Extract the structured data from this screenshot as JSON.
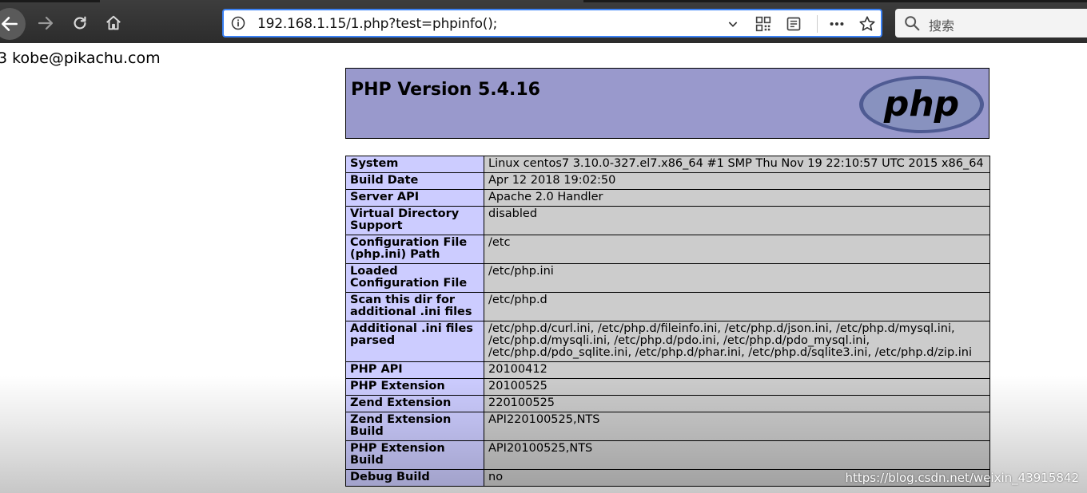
{
  "browser": {
    "url": "192.168.1.15/1.php?test=phpinfo();",
    "search_placeholder": "搜索",
    "icons": [
      "back-icon",
      "forward-icon",
      "reload-icon",
      "home-icon",
      "info-icon",
      "chevron-down-icon",
      "qr-code-icon",
      "reader-view-icon",
      "more-icon",
      "star-icon",
      "search-icon"
    ]
  },
  "page": {
    "email_text": "3 kobe@pikachu.com",
    "php_version": "PHP Version 5.4.16",
    "logo_text": "php",
    "rows": [
      {
        "key": "System",
        "value": "Linux centos7 3.10.0-327.el7.x86_64 #1 SMP Thu Nov 19 22:10:57 UTC 2015 x86_64"
      },
      {
        "key": "Build Date",
        "value": "Apr 12 2018 19:02:50"
      },
      {
        "key": "Server API",
        "value": "Apache 2.0 Handler"
      },
      {
        "key": "Virtual Directory Support",
        "value": "disabled"
      },
      {
        "key": "Configuration File (php.ini) Path",
        "value": "/etc"
      },
      {
        "key": "Loaded Configuration File",
        "value": "/etc/php.ini"
      },
      {
        "key": "Scan this dir for additional .ini files",
        "value": "/etc/php.d"
      },
      {
        "key": "Additional .ini files parsed",
        "value": "/etc/php.d/curl.ini, /etc/php.d/fileinfo.ini, /etc/php.d/json.ini, /etc/php.d/mysql.ini, /etc/php.d/mysqli.ini, /etc/php.d/pdo.ini, /etc/php.d/pdo_mysql.ini, /etc/php.d/pdo_sqlite.ini, /etc/php.d/phar.ini, /etc/php.d/sqlite3.ini, /etc/php.d/zip.ini"
      },
      {
        "key": "PHP API",
        "value": "20100412"
      },
      {
        "key": "PHP Extension",
        "value": "20100525"
      },
      {
        "key": "Zend Extension",
        "value": "220100525"
      },
      {
        "key": "Zend Extension Build",
        "value": "API220100525,NTS"
      },
      {
        "key": "PHP Extension Build",
        "value": "API20100525,NTS"
      },
      {
        "key": "Debug Build",
        "value": "no"
      }
    ]
  },
  "watermark": "https://blog.csdn.net/weixin_43915842",
  "colors": {
    "header_bg": "#9999cc",
    "key_bg": "#ccccff",
    "value_bg": "#cccccc",
    "url_focus": "#3b82f6"
  }
}
